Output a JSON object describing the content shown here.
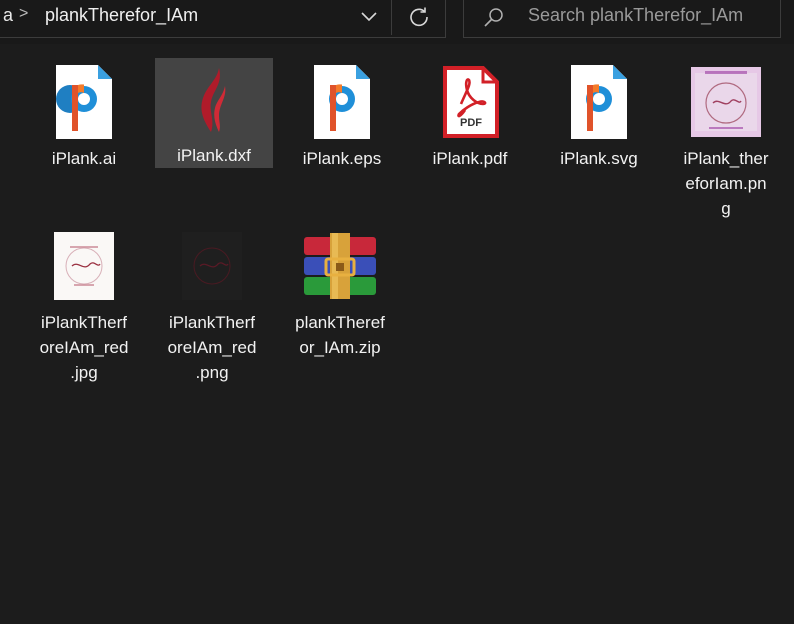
{
  "address_bar": {
    "fragment": "a",
    "separator": ">",
    "current_folder": "plankTherefor_IAm"
  },
  "search": {
    "placeholder": "Search plankTherefor_IAm"
  },
  "files": [
    {
      "name": "iPlank.ai",
      "label_lines": [
        "iPlank.ai"
      ],
      "icon": "corel-pdf-file-icon",
      "selected": false
    },
    {
      "name": "iPlank.dxf",
      "label_lines": [
        "iPlank.dxf"
      ],
      "icon": "dxf-flame-icon",
      "selected": true
    },
    {
      "name": "iPlank.eps",
      "label_lines": [
        "iPlank.eps"
      ],
      "icon": "corel-pdf-file-icon",
      "selected": false
    },
    {
      "name": "iPlank.pdf",
      "label_lines": [
        "iPlank.pdf"
      ],
      "icon": "acrobat-pdf-icon",
      "selected": false
    },
    {
      "name": "iPlank.svg",
      "label_lines": [
        "iPlank.svg"
      ],
      "icon": "corel-pdf-file-icon",
      "selected": false
    },
    {
      "name": "iPlank_thereforIam.png",
      "label_lines": [
        "iPlank_ther",
        "eforIam.pn",
        "g"
      ],
      "icon": "image-thumbnail-pink",
      "selected": false
    },
    {
      "name": "iPlankTherforeIAm_red.jpg",
      "label_lines": [
        "iPlankTherf",
        "oreIAm_red",
        ".jpg"
      ],
      "icon": "image-thumbnail-white",
      "selected": false
    },
    {
      "name": "iPlankTherforeIAm_red.png",
      "label_lines": [
        "iPlankTherf",
        "oreIAm_red",
        ".png"
      ],
      "icon": "image-thumbnail-dark",
      "selected": false
    },
    {
      "name": "plankTherefor_IAm.zip",
      "label_lines": [
        "plankTheref",
        "or_IAm.zip"
      ],
      "icon": "winrar-archive-icon",
      "selected": false
    }
  ],
  "colors": {
    "background": "#1c1c1c",
    "selected": "#444444",
    "text": "#f2f2f2",
    "placeholder": "#9a9a9a"
  }
}
